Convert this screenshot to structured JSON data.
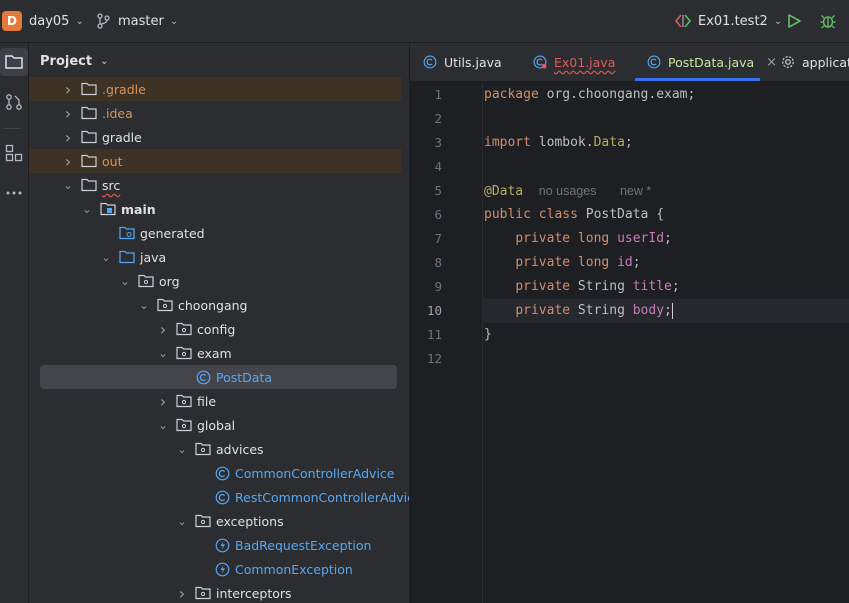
{
  "topbar": {
    "project_badge": "D",
    "project_name": "day05",
    "branch": "master",
    "run_config": "Ex01.test2"
  },
  "project_panel": {
    "title": "Project",
    "tree": [
      {
        "label": ".gradle",
        "depth": 0,
        "arrow": "right",
        "icon": "folder-icon",
        "style": "orange",
        "highlight": true
      },
      {
        "label": ".idea",
        "depth": 0,
        "arrow": "right",
        "icon": "folder-icon",
        "style": "orange",
        "highlight": false
      },
      {
        "label": "gradle",
        "depth": 0,
        "arrow": "right",
        "icon": "folder-icon",
        "style": "normal",
        "highlight": false
      },
      {
        "label": "out",
        "depth": 0,
        "arrow": "right",
        "icon": "folder-icon",
        "style": "orange",
        "highlight": true
      },
      {
        "label": "src",
        "depth": 0,
        "arrow": "down",
        "icon": "folder-icon",
        "style": "wavy",
        "highlight": false
      },
      {
        "label": "main",
        "depth": 1,
        "arrow": "down",
        "icon": "source-root-folder-icon",
        "style": "bold",
        "highlight": false
      },
      {
        "label": "generated",
        "depth": 2,
        "arrow": "none",
        "icon": "generated-folder-icon",
        "style": "normal",
        "highlight": false
      },
      {
        "label": "java",
        "depth": 2,
        "arrow": "down",
        "icon": "blue-folder-icon",
        "style": "normal",
        "highlight": false
      },
      {
        "label": "org",
        "depth": 3,
        "arrow": "down",
        "icon": "package-icon",
        "style": "normal",
        "highlight": false
      },
      {
        "label": "choongang",
        "depth": 4,
        "arrow": "down",
        "icon": "package-icon",
        "style": "normal",
        "highlight": false
      },
      {
        "label": "config",
        "depth": 5,
        "arrow": "right",
        "icon": "package-icon",
        "style": "normal",
        "highlight": false
      },
      {
        "label": "exam",
        "depth": 5,
        "arrow": "down",
        "icon": "package-icon",
        "style": "normal",
        "highlight": false
      },
      {
        "label": "PostData",
        "depth": 6,
        "arrow": "none",
        "icon": "class-icon",
        "style": "blue",
        "selected": true
      },
      {
        "label": "file",
        "depth": 5,
        "arrow": "right",
        "icon": "package-icon",
        "style": "normal",
        "highlight": false
      },
      {
        "label": "global",
        "depth": 5,
        "arrow": "down",
        "icon": "package-icon",
        "style": "normal",
        "highlight": false
      },
      {
        "label": "advices",
        "depth": 6,
        "arrow": "down",
        "icon": "package-icon",
        "style": "normal",
        "highlight": false
      },
      {
        "label": "CommonControllerAdvice",
        "depth": 7,
        "arrow": "none",
        "icon": "class-icon",
        "style": "blue",
        "highlight": false
      },
      {
        "label": "RestCommonControllerAdvice",
        "depth": 7,
        "arrow": "none",
        "icon": "class-icon",
        "style": "blue",
        "highlight": false
      },
      {
        "label": "exceptions",
        "depth": 6,
        "arrow": "down",
        "icon": "package-icon",
        "style": "normal",
        "highlight": false
      },
      {
        "label": "BadRequestException",
        "depth": 7,
        "arrow": "none",
        "icon": "exception-class-icon",
        "style": "blue",
        "highlight": false
      },
      {
        "label": "CommonException",
        "depth": 7,
        "arrow": "none",
        "icon": "exception-class-icon",
        "style": "blue",
        "highlight": false
      },
      {
        "label": "interceptors",
        "depth": 6,
        "arrow": "right",
        "icon": "package-icon",
        "style": "normal",
        "highlight": false
      }
    ]
  },
  "editor": {
    "tabs": [
      {
        "label": "Utils.java",
        "icon": "class-icon",
        "active": false,
        "error": false
      },
      {
        "label": "Ex01.java",
        "icon": "test-class-icon",
        "active": false,
        "error": true
      },
      {
        "label": "PostData.java",
        "icon": "class-icon",
        "active": true,
        "error": false,
        "close": "×"
      },
      {
        "label": "applicatio",
        "icon": "settings-icon",
        "active": false,
        "error": false
      }
    ],
    "line_numbers": [
      "1",
      "2",
      "3",
      "4",
      "5",
      "6",
      "7",
      "8",
      "9",
      "10",
      "11",
      "12"
    ],
    "current_line": "10",
    "code": {
      "l1_kw": "package",
      "l1_rest": " org.choongang.exam;",
      "l3_kw": "import",
      "l3_pkg": " lombok.",
      "l3_cls": "Data",
      "l3_end": ";",
      "l5_ann": "@Data",
      "l5_usages": "no usages",
      "l5_new": "new *",
      "l6_kw": "public class",
      "l6_rest": " PostData {",
      "l7_kw": "private long",
      "l7_fld": "userId",
      "l7_end": ";",
      "l8_kw": "private long",
      "l8_fld": "id",
      "l8_end": ";",
      "l9_kw": "private",
      "l9_type": " String ",
      "l9_fld": "title",
      "l9_end": ";",
      "l10_kw": "private",
      "l10_type": " String ",
      "l10_fld": "body",
      "l10_end": ";",
      "l11": "}"
    }
  },
  "colors": {
    "accent": "#3574f0",
    "keyword": "#cf8e6d",
    "annotation": "#b3ae60",
    "field": "#c77dbb",
    "excluded_folder": "#d9945b",
    "class_link": "#56a8f5"
  }
}
